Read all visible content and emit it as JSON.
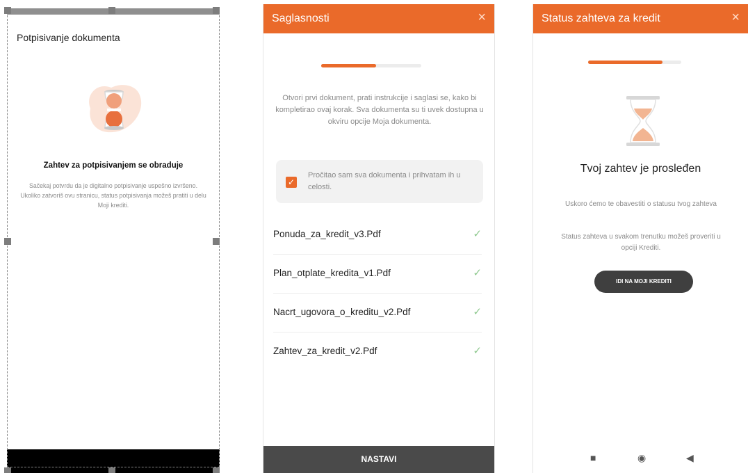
{
  "screen1": {
    "title": "Potpisivanje dokumenta",
    "heading": "Zahtev za potpisivanjem se obraduje",
    "description": "Sačekaj potvrdu da je digitalno potpisivanje uspešno izvršeno. Ukoliko zatvoriš ovu stranicu, status potpisivanja možeš pratiti u delu Moji krediti."
  },
  "screen2": {
    "title": "Saglasnosti",
    "close_icon": "×",
    "progress": 0.55,
    "instructions": "Otvori prvi dokument, prati instrukcije i saglasi se, kako bi kompletirao ovaj korak. Sva dokumenta su ti uvek dostupna u okviru opcije Moja dokumenta.",
    "consent_text": "Pročitao sam sva dokumenta i prihvatam ih u celosti.",
    "checkbox_mark": "✓",
    "documents": [
      {
        "name": "Ponuda_za_kredit_v3.Pdf",
        "check": "✓"
      },
      {
        "name": "Plan_otplate_kredita_v1.Pdf",
        "check": "✓"
      },
      {
        "name": "Nacrt_ugovora_o_kreditu_v2.Pdf",
        "check": "✓"
      },
      {
        "name": "Zahtev_za_kredit_v2.Pdf",
        "check": "✓"
      }
    ],
    "continue_label": "NASTAVI"
  },
  "screen3": {
    "title": "Status zahteva za kredit",
    "close_icon": "×",
    "progress": 0.8,
    "status_title": "Tvoj zahtev je prosleđen",
    "line1": "Uskoro ćemo te obavestiti o statusu tvog zahteva",
    "line2": "Status zahteva u svakom trenutku možeš proveriti u opciji Krediti.",
    "button_label": "IDI NA MOJI KREDITI",
    "nav": {
      "square": "■",
      "home": "◉",
      "back": "◀"
    }
  },
  "colors": {
    "accent": "#ea6a2a",
    "button_dark": "#3f3f3f",
    "muted_text": "#8a8a8a"
  }
}
